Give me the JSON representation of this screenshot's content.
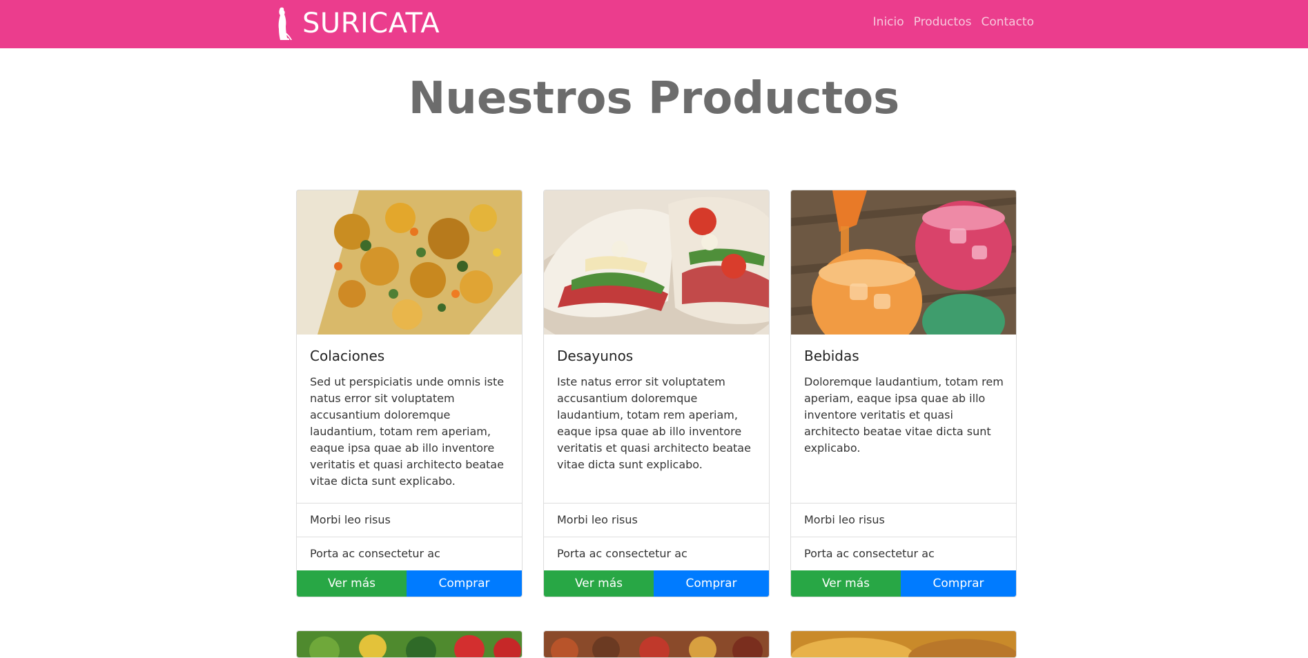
{
  "navbar": {
    "brand": "SURICATA",
    "links": [
      "Inicio",
      "Productos",
      "Contacto"
    ],
    "bg_color": "#eb3d8d"
  },
  "page": {
    "title": "Nuestros Productos"
  },
  "cards": [
    {
      "title": "Colaciones",
      "text": "Sed ut perspiciatis unde omnis iste natus error sit voluptatem accusantium doloremque laudantium, totam rem aperiam, eaque ipsa quae ab illo inventore veritatis et quasi architecto beatae vitae dicta sunt explicabo.",
      "list": [
        "Morbi leo risus",
        "Porta ac consectetur ac"
      ],
      "btn_more": "Ver más",
      "btn_buy": "Comprar"
    },
    {
      "title": "Desayunos",
      "text": "Iste natus error sit voluptatem accusantium doloremque laudantium, totam rem aperiam, eaque ipsa quae ab illo inventore veritatis et quasi architecto beatae vitae dicta sunt explicabo.",
      "list": [
        "Morbi leo risus",
        "Porta ac consectetur ac"
      ],
      "btn_more": "Ver más",
      "btn_buy": "Comprar"
    },
    {
      "title": "Bebidas",
      "text": "Doloremque laudantium, totam rem aperiam, eaque ipsa quae ab illo inventore veritatis et quasi architecto beatae vitae dicta sunt explicabo.",
      "list": [
        "Morbi leo risus",
        "Porta ac consectetur ac"
      ],
      "btn_more": "Ver más",
      "btn_buy": "Comprar"
    }
  ],
  "colors": {
    "btn_green": "#28a745",
    "btn_blue": "#007bff",
    "title_gray": "#6c6c6c"
  }
}
